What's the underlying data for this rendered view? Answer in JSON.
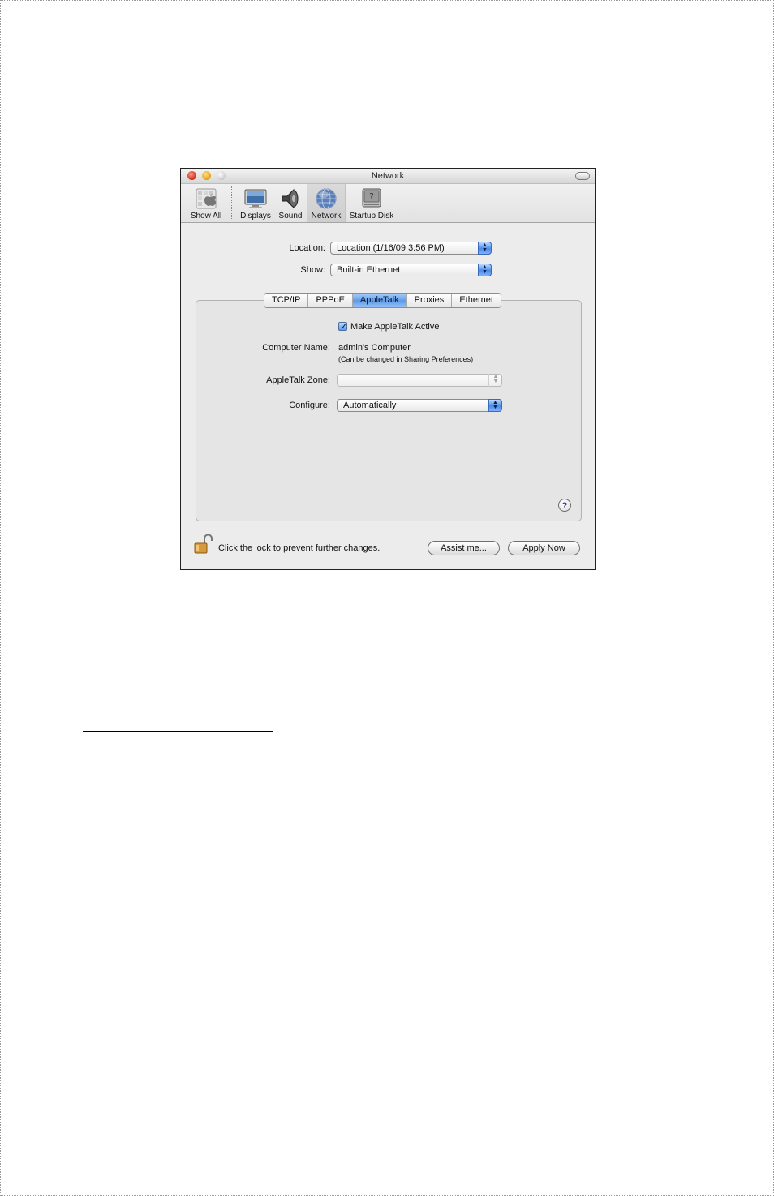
{
  "window": {
    "title": "Network"
  },
  "toolbar": {
    "items": [
      {
        "label": "Show All",
        "icon": "apple-grid-icon"
      },
      {
        "label": "Displays",
        "icon": "display-icon"
      },
      {
        "label": "Sound",
        "icon": "speaker-icon"
      },
      {
        "label": "Network",
        "icon": "globe-icon",
        "selected": true
      },
      {
        "label": "Startup Disk",
        "icon": "hard-disk-icon"
      }
    ]
  },
  "location": {
    "label": "Location:",
    "value": "Location (1/16/09 3:56 PM)"
  },
  "show": {
    "label": "Show:",
    "value": "Built-in Ethernet"
  },
  "tabs": [
    {
      "label": "TCP/IP"
    },
    {
      "label": "PPPoE"
    },
    {
      "label": "AppleTalk",
      "active": true
    },
    {
      "label": "Proxies"
    },
    {
      "label": "Ethernet"
    }
  ],
  "appletalk": {
    "active_checkbox_label": "Make AppleTalk Active",
    "active_checked": true,
    "computer_name_label": "Computer Name:",
    "computer_name_value": "admin's Computer",
    "computer_name_hint": "(Can be changed in Sharing Preferences)",
    "zone_label": "AppleTalk Zone:",
    "zone_value": "",
    "configure_label": "Configure:",
    "configure_value": "Automatically"
  },
  "footer": {
    "lock_text": "Click the lock to prevent further changes.",
    "assist_label": "Assist me...",
    "apply_label": "Apply Now"
  },
  "colors": {
    "accent_blue": "#5c9ae8",
    "close_red": "#d2331f",
    "minimize_yellow": "#e0a51c"
  }
}
